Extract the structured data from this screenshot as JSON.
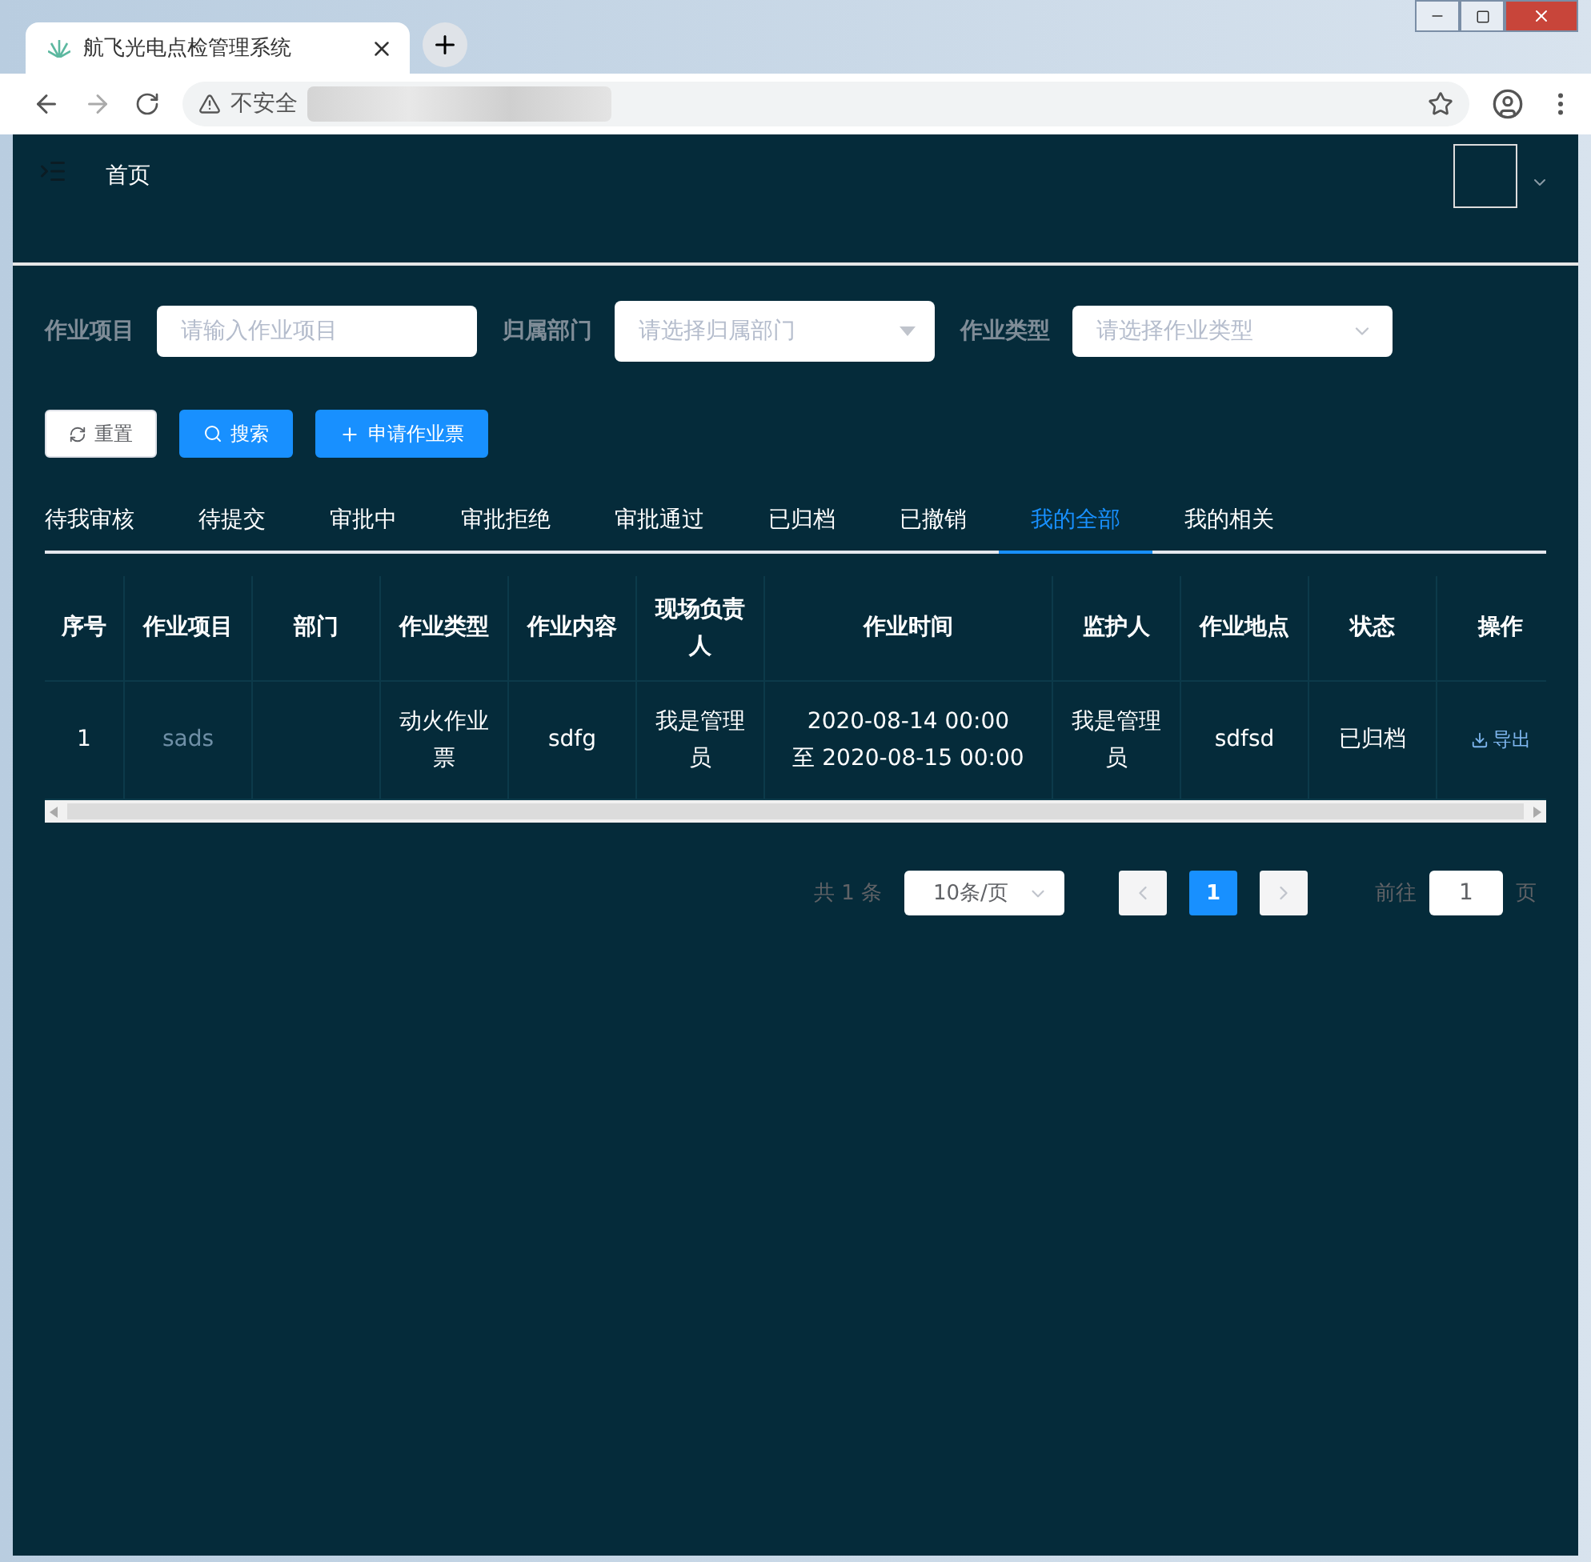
{
  "browser": {
    "tab_title": "航飞光电点检管理系统",
    "security": "不安全"
  },
  "header": {
    "breadcrumb": "首页"
  },
  "filters": [
    {
      "label": "作业项目",
      "placeholder": "请输入作业项目",
      "kind": "input"
    },
    {
      "label": "归属部门",
      "placeholder": "请选择归属部门",
      "kind": "dropdown"
    },
    {
      "label": "作业类型",
      "placeholder": "请选择作业类型",
      "kind": "select"
    }
  ],
  "buttons": [
    {
      "label": "重置",
      "kind": "reset"
    },
    {
      "label": "搜索",
      "kind": "search"
    },
    {
      "label": "申请作业票",
      "kind": "add"
    }
  ],
  "tabs": [
    {
      "label": "待我审核",
      "selected": false
    },
    {
      "label": "待提交",
      "selected": false
    },
    {
      "label": "审批中",
      "selected": false
    },
    {
      "label": "审批拒绝",
      "selected": false
    },
    {
      "label": "审批通过",
      "selected": false
    },
    {
      "label": "已归档",
      "selected": false
    },
    {
      "label": "已撤销",
      "selected": false
    },
    {
      "label": "我的全部",
      "selected": true
    },
    {
      "label": "我的相关",
      "selected": false
    }
  ],
  "table": {
    "columns": [
      "序号",
      "作业项目",
      "部门",
      "作业类型",
      "作业内容",
      "现场负责人",
      "作业时间",
      "监护人",
      "作业地点",
      "状态",
      "操作"
    ],
    "rows": [
      {
        "cells": [
          "1",
          "sads",
          "",
          "动火作业票",
          "sdfg",
          "我是管理员",
          "2020-08-14 00:00\n至 2020-08-15 00:00",
          "我是管理员",
          "sdfsd",
          "已归档"
        ],
        "action": "导出"
      }
    ]
  },
  "pagination": {
    "total": "共 1 条",
    "page_size": "10条/页",
    "pages": [
      {
        "label": "1",
        "selected": true
      }
    ],
    "goto_label": "前往",
    "goto_value": "1",
    "goto_suffix": "页"
  }
}
